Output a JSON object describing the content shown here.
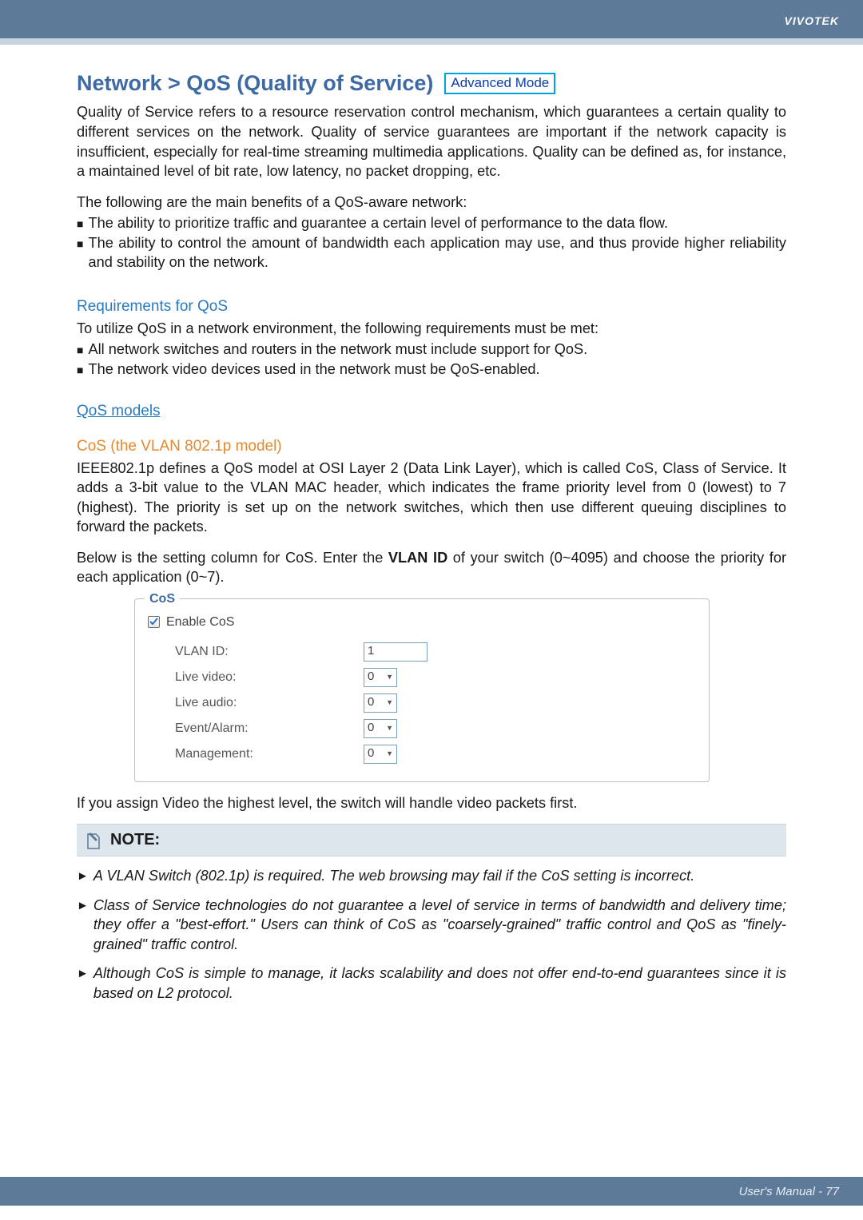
{
  "brand": "VIVOTEK",
  "footer": "User's Manual - 77",
  "title": "Network > QoS (Quality of Service)",
  "mode_badge": "Advanced Mode",
  "intro": "Quality of Service refers to a resource reservation control mechanism, which guarantees a certain quality to different services on the network. Quality of service guarantees are important if the network capacity is insufficient, especially for real-time streaming multimedia applications. Quality can be defined as, for instance, a maintained level of bit rate, low latency, no packet dropping, etc.",
  "benefits_lead": "The following are the main benefits of a QoS-aware network:",
  "benefits": [
    "The ability to prioritize traffic and guarantee a certain level of performance to the data flow.",
    "The ability to control the amount of bandwidth each application may use, and thus provide higher reliability and stability on the network."
  ],
  "req_heading": "Requirements for QoS",
  "req_lead": "To utilize QoS in a network environment, the following requirements must be met:",
  "req_items": [
    "All network switches and routers in the network must include support for QoS.",
    "The network video devices used in the network must be QoS-enabled."
  ],
  "models_heading": "QoS models",
  "cos_heading": "CoS (the VLAN 802.1p model)",
  "cos_para": "IEEE802.1p defines a QoS model at OSI Layer 2 (Data Link Layer), which is called CoS, Class of Service. It adds a 3-bit value to the VLAN MAC header, which indicates the frame priority level from 0 (lowest) to 7 (highest). The priority is set up on the network switches, which then use different queuing disciplines to forward the packets.",
  "cos_setting_pre": "Below is the setting column for CoS. Enter the ",
  "cos_setting_bold": "VLAN ID",
  "cos_setting_post": " of your switch (0~4095) and choose the priority for each application (0~7).",
  "panel": {
    "legend": "CoS",
    "enable_label": "Enable CoS",
    "enable_checked": true,
    "fields": {
      "vlan_label": "VLAN ID:",
      "vlan_value": "1",
      "live_video_label": "Live video:",
      "live_video_value": "0",
      "live_audio_label": "Live audio:",
      "live_audio_value": "0",
      "event_label": "Event/Alarm:",
      "event_value": "0",
      "mgmt_label": "Management:",
      "mgmt_value": "0"
    }
  },
  "after_panel": "If you assign Video the highest level, the switch will handle video packets first.",
  "note_title": "NOTE:",
  "notes": [
    "A VLAN Switch (802.1p) is required. The web browsing may fail if the CoS setting is incorrect.",
    "Class of Service technologies do not guarantee a level of service in terms of bandwidth and delivery time; they offer a \"best-effort.\" Users can think of CoS as \"coarsely-grained\" traffic control and QoS as \"finely-grained\" traffic control.",
    "Although CoS is simple to manage, it lacks scalability and does not offer end-to-end guarantees since it is based on L2 protocol."
  ]
}
